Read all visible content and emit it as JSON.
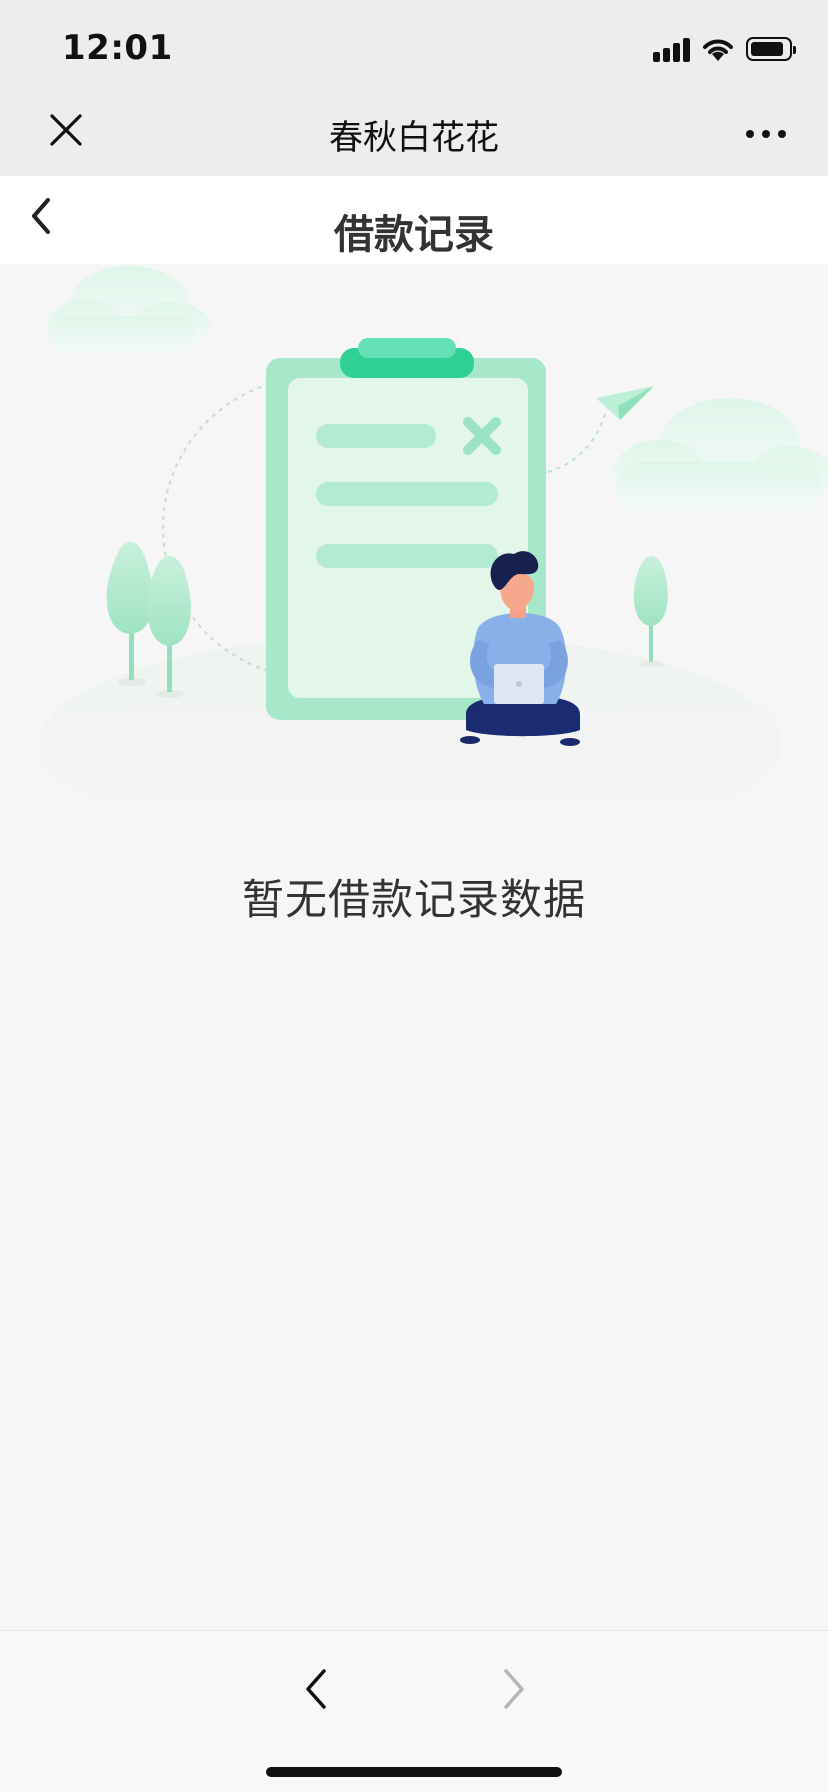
{
  "status_bar": {
    "time": "12:01"
  },
  "mini_program_bar": {
    "title": "春秋白花花",
    "close_icon": "close-icon",
    "more_icon": "more-icon"
  },
  "header": {
    "title": "借款记录",
    "back_icon": "chevron-left-icon"
  },
  "empty_state": {
    "message": "暂无借款记录数据",
    "illustration": "clipboard-with-person-illustration"
  },
  "bottom_nav": {
    "back_icon": "chevron-left-icon",
    "forward_icon": "chevron-right-icon"
  },
  "colors": {
    "accent_green": "#2fcf96",
    "light_green": "#b3ebd2",
    "page_bg": "#f6f6f6",
    "nav_bg": "#ededed",
    "title_text": "#333333"
  }
}
